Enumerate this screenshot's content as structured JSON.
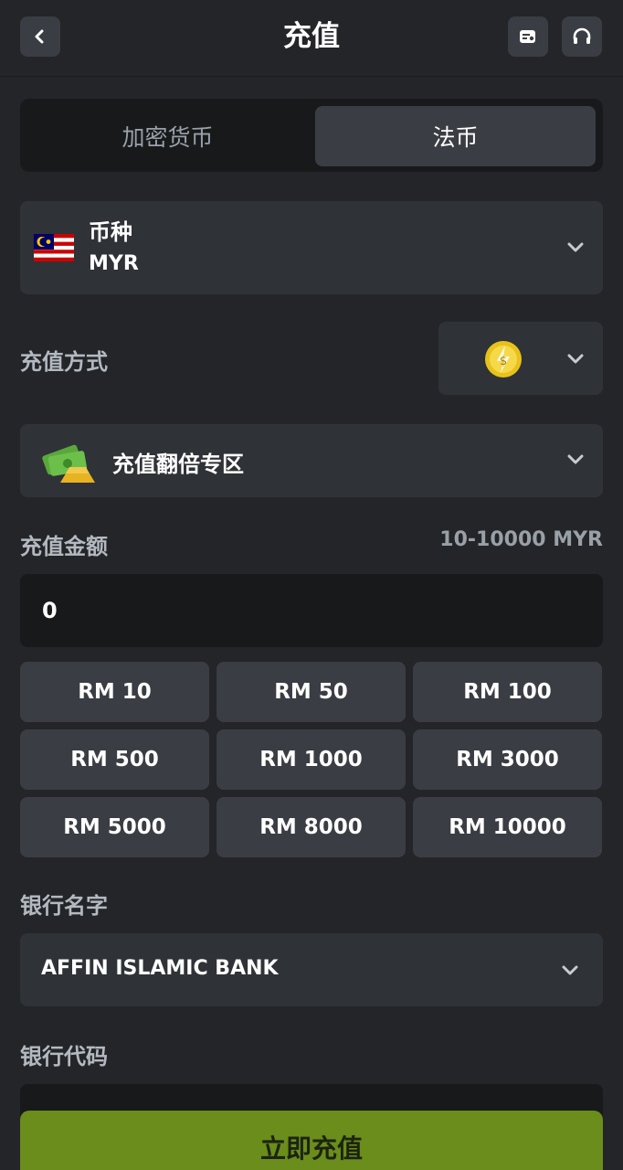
{
  "header": {
    "title": "充值",
    "back_icon": "chevron-left-icon",
    "wallet_icon": "wallet-icon",
    "support_icon": "headset-icon"
  },
  "tabs": [
    {
      "label": "加密货币",
      "active": false
    },
    {
      "label": "法币",
      "active": true
    }
  ],
  "currency": {
    "label": "币种",
    "value": "MYR",
    "flag_icon": "malaysia-flag-icon"
  },
  "payment_method": {
    "label": "充值方式",
    "selected_icon": "gold-coin-lightning-icon"
  },
  "promo": {
    "label": "充值翻倍专区",
    "icon": "money-stack-icon"
  },
  "amount": {
    "label": "充值金额",
    "range": "10-10000 MYR",
    "value": "0"
  },
  "quick_amounts": [
    "RM 10",
    "RM 50",
    "RM 100",
    "RM 500",
    "RM 1000",
    "RM 3000",
    "RM 5000",
    "RM 8000",
    "RM 10000"
  ],
  "bank": {
    "label": "银行名字",
    "value": "AFFIN ISLAMIC BANK"
  },
  "bank_code": {
    "label": "银行代码",
    "value": ""
  },
  "submit": {
    "label": "立即充值"
  },
  "colors": {
    "background": "#232528",
    "panel": "#2f3237",
    "input": "#18191b",
    "button": "#3a3d43",
    "accent": "#6b8d1b",
    "muted_text": "#9aa0a8"
  }
}
